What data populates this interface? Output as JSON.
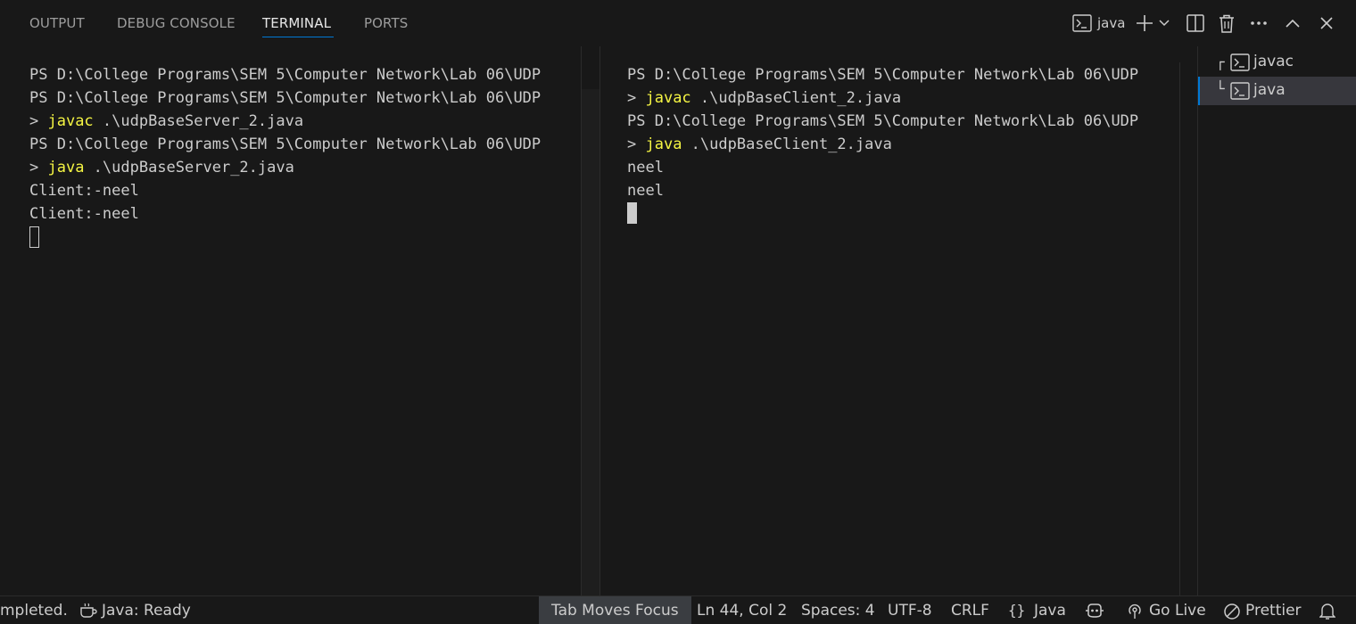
{
  "panel": {
    "tabs": [
      {
        "label": "OUTPUT"
      },
      {
        "label": "DEBUG CONSOLE"
      },
      {
        "label": "TERMINAL"
      },
      {
        "label": "PORTS"
      }
    ],
    "active_terminal": "java",
    "icons": {
      "terminal": "terminal-icon",
      "add": "plus-icon",
      "dropdown": "chevron-down-icon",
      "split": "split-editor-icon",
      "kill": "trash-icon",
      "more": "ellipsis-icon",
      "maximize": "chevron-up-icon",
      "close": "close-icon"
    }
  },
  "terminal_left": {
    "lines": [
      {
        "prefix": "PS D:\\College Programs\\SEM 5\\Computer Network\\Lab 06\\UDP",
        "cmd": "",
        "rest": ""
      },
      {
        "prefix": "PS D:\\College Programs\\SEM 5\\Computer Network\\Lab 06\\UDP",
        "cmd": "",
        "rest": ""
      },
      {
        "prefix": "> ",
        "cmd": "javac",
        "rest": " .\\udpBaseServer_2.java"
      },
      {
        "prefix": "PS D:\\College Programs\\SEM 5\\Computer Network\\Lab 06\\UDP",
        "cmd": "",
        "rest": ""
      },
      {
        "prefix": "> ",
        "cmd": "java",
        "rest": " .\\udpBaseServer_2.java"
      },
      {
        "prefix": "Client:-neel",
        "cmd": "",
        "rest": ""
      },
      {
        "prefix": "Client:-neel",
        "cmd": "",
        "rest": ""
      }
    ]
  },
  "terminal_right": {
    "lines": [
      {
        "prefix": "PS D:\\College Programs\\SEM 5\\Computer Network\\Lab 06\\UDP",
        "cmd": "",
        "rest": ""
      },
      {
        "prefix": "> ",
        "cmd": "javac",
        "rest": " .\\udpBaseClient_2.java"
      },
      {
        "prefix": "PS D:\\College Programs\\SEM 5\\Computer Network\\Lab 06\\UDP",
        "cmd": "",
        "rest": ""
      },
      {
        "prefix": "> ",
        "cmd": "java",
        "rest": " .\\udpBaseClient_2.java"
      },
      {
        "prefix": "neel",
        "cmd": "",
        "rest": ""
      },
      {
        "prefix": "neel",
        "cmd": "",
        "rest": ""
      }
    ]
  },
  "terminal_list": {
    "items": [
      {
        "glyph": "┌",
        "label": "javac",
        "selected": false
      },
      {
        "glyph": "└",
        "label": "java",
        "selected": true
      }
    ]
  },
  "status_bar": {
    "task": "mpleted.",
    "java_status": "Java: Ready",
    "tab_focus": "Tab Moves Focus",
    "position": "Ln 44, Col 2",
    "spaces": "Spaces: 4",
    "encoding": "UTF-8",
    "eol": "CRLF",
    "language_braces": "{}",
    "language": "Java",
    "go_live": "Go Live",
    "prettier": "Prettier"
  },
  "colors": {
    "background": "#181818",
    "command": "#f5f543",
    "accent": "#0078d4",
    "text": "#cccccc"
  }
}
